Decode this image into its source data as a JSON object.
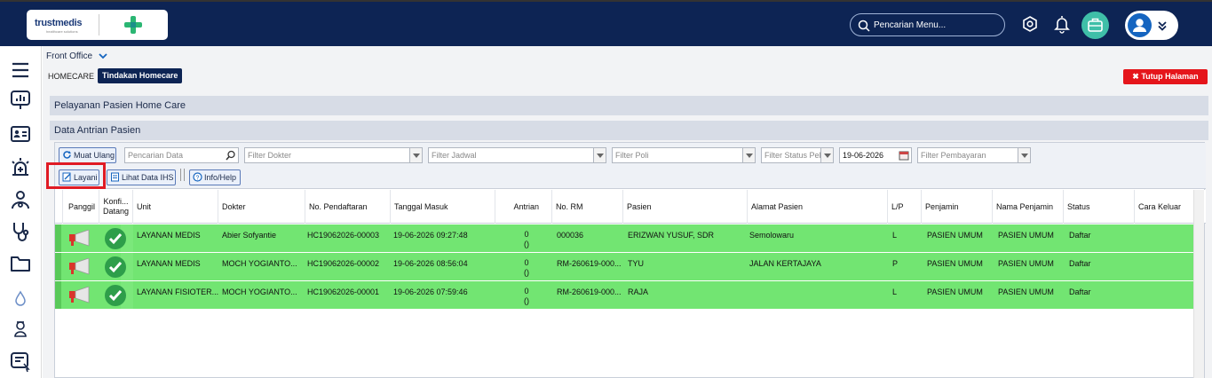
{
  "header": {
    "brand": "trustmedis",
    "brand_sub": "healthcare solutions",
    "search_placeholder": "Pencarian Menu..."
  },
  "page": {
    "module": "Front Office",
    "breadcrumb_root": "HOMECARE",
    "breadcrumb_active": "Tindakan Homecare",
    "close_button": "Tutup Halaman",
    "section_title": "Pelayanan Pasien Home Care",
    "list_title": "Data Antrian Pasien"
  },
  "toolbar": {
    "reload": "Muat Ulang",
    "search_placeholder": "Pencarian Data",
    "filter_dokter": "Filter Dokter",
    "filter_jadwal": "Filter Jadwal",
    "filter_poli": "Filter Poli",
    "filter_status": "Filter Status Pel",
    "date": "19-06-2026",
    "filter_pembayaran": "Filter Pembayaran",
    "layani": "Layani",
    "lihat_ihs": "Lihat Data IHS",
    "info_help": "Info/Help"
  },
  "table": {
    "columns": {
      "panggil": "Panggil",
      "konfirmasi_1": "Konfi...",
      "konfirmasi_2": "Datang",
      "unit": "Unit",
      "dokter": "Dokter",
      "no_pendaftaran": "No. Pendaftaran",
      "tanggal_masuk": "Tanggal Masuk",
      "antrian": "Antrian",
      "no_rm": "No. RM",
      "pasien": "Pasien",
      "alamat": "Alamat Pasien",
      "lp": "L/P",
      "penjamin": "Penjamin",
      "nama_penjamin": "Nama Penjamin",
      "status": "Status",
      "cara_keluar": "Cara Keluar"
    },
    "rows": [
      {
        "unit": "LAYANAN MEDIS",
        "dokter": "Abier Sofyantie",
        "no_pendaftaran": "HC19062026-00003",
        "tanggal_masuk": "19-06-2026 09:27:48",
        "antrian_1": "0",
        "antrian_2": "()",
        "no_rm": "000036",
        "pasien": "ERIZWAN YUSUF, SDR",
        "alamat": "Semolowaru",
        "lp": "L",
        "penjamin": "PASIEN UMUM",
        "nama_penjamin": "PASIEN UMUM",
        "status": "Daftar"
      },
      {
        "unit": "LAYANAN MEDIS",
        "dokter": "MOCH YOGIANTO...",
        "no_pendaftaran": "HC19062026-00002",
        "tanggal_masuk": "19-06-2026 08:56:04",
        "antrian_1": "0",
        "antrian_2": "()",
        "no_rm": "RM-260619-000...",
        "pasien": "TYU",
        "alamat": "JALAN KERTAJAYA",
        "lp": "P",
        "penjamin": "PASIEN UMUM",
        "nama_penjamin": "PASIEN UMUM",
        "status": "Daftar"
      },
      {
        "unit": "LAYANAN FISIOTER...",
        "dokter": "MOCH YOGIANTO...",
        "no_pendaftaran": "HC19062026-00001",
        "tanggal_masuk": "19-06-2026 07:59:46",
        "antrian_1": "0",
        "antrian_2": "()",
        "no_rm": "RM-260619-000...",
        "pasien": "RAJA",
        "alamat": "",
        "lp": "L",
        "penjamin": "PASIEN UMUM",
        "nama_penjamin": "PASIEN UMUM",
        "status": "Daftar"
      }
    ]
  },
  "icons": {
    "sidebar": [
      "menu-icon",
      "dashboard-icon",
      "id-card-icon",
      "emergency-icon",
      "stethoscope-user-icon",
      "stethoscope-icon",
      "folder-icon",
      "drop-icon",
      "nurse-icon",
      "report-icon"
    ]
  },
  "colors": {
    "header_bg": "#0d2454",
    "row_bg": "#72e572",
    "close_bg": "#e5151b",
    "highlight": "#e01b24"
  }
}
